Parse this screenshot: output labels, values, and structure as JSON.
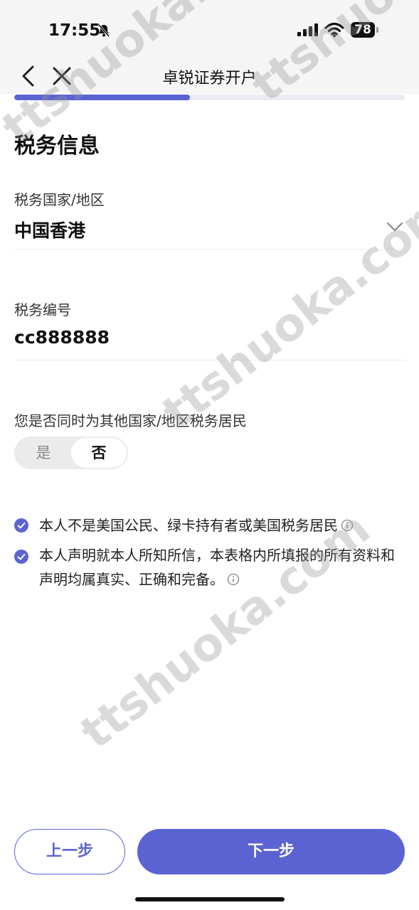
{
  "status_bar": {
    "time": "17:55",
    "battery": "78"
  },
  "nav": {
    "title": "卓锐证券开户"
  },
  "progress": {
    "fraction": 0.45
  },
  "section_title": "税务信息",
  "fields": {
    "tax_country": {
      "label": "税务国家/地区",
      "value": "中国香港"
    },
    "tax_number": {
      "label": "税务编号",
      "value": "cc888888"
    }
  },
  "other_resident": {
    "question": "您是否同时为其他国家/地区税务居民",
    "options": [
      "是",
      "否"
    ],
    "selected": "否"
  },
  "declarations": [
    {
      "text": "本人不是美国公民、绿卡持有者或美国税务居民"
    },
    {
      "text": "本人声明就本人所知所信，本表格内所填报的所有资料和声明均属真实、正确和完备。"
    }
  ],
  "buttons": {
    "prev": "上一步",
    "next": "下一步"
  },
  "watermark_text": "ttshuoka.com",
  "colors": {
    "accent": "#5b63d3",
    "status_bg": "#f5f5f5"
  }
}
